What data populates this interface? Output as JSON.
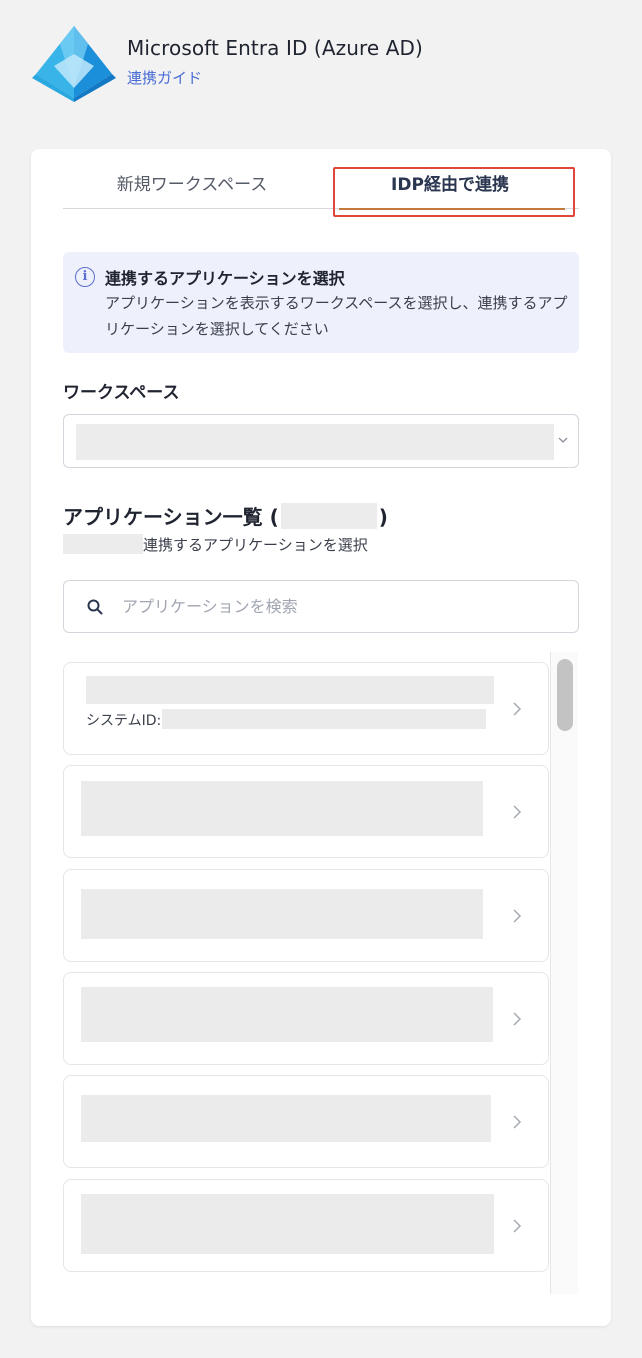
{
  "header": {
    "title": "Microsoft Entra ID (Azure AD)",
    "guide_link": "連携ガイド",
    "logo_icon": "azure-ad-pyramid-icon"
  },
  "tabs": [
    {
      "label": "新規ワークスペース",
      "active": false
    },
    {
      "label": "IDP経由で連携",
      "active": true
    }
  ],
  "info": {
    "title": "連携するアプリケーションを選択",
    "description": "アプリケーションを表示するワークスペースを選択し、連携するアプリケーションを選択してください"
  },
  "workspace": {
    "label": "ワークスペース"
  },
  "app_list": {
    "title_prefix": "アプリケーション一覧 (",
    "title_suffix": ")",
    "subtitle_suffix": "連携するアプリケーションを選択",
    "search_placeholder": "アプリケーションを検索",
    "system_id_label": "システムID:"
  },
  "colors": {
    "accent": "#4a6cd6",
    "tab_underline": "#c47a3c",
    "highlight_box": "#e0473a",
    "info_bg": "#eef1fb"
  }
}
